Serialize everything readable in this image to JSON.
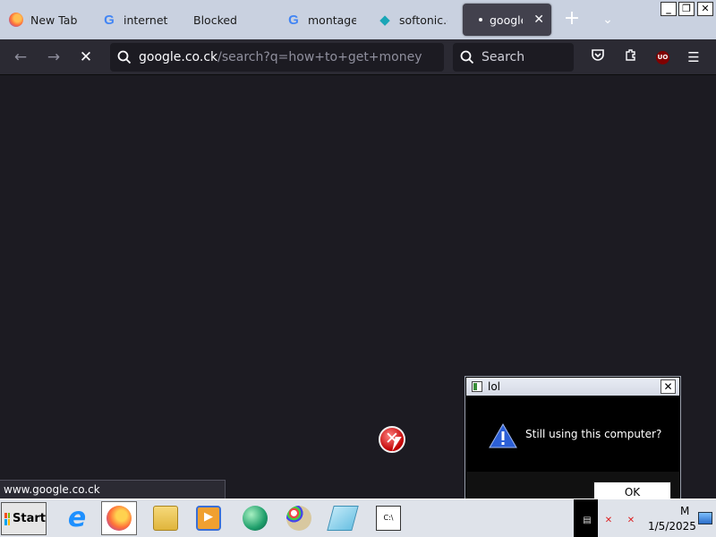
{
  "browser": {
    "tabs": [
      {
        "label": "New Tab",
        "favicon": "firefox-icon"
      },
      {
        "label": "internet ex",
        "favicon": "google-icon"
      },
      {
        "label": "Blocked",
        "favicon": ""
      },
      {
        "label": "montage p",
        "favicon": "google-icon"
      },
      {
        "label": "softonic.co",
        "favicon": "softonic-icon"
      },
      {
        "label": "google.c",
        "favicon": "",
        "active": true
      }
    ],
    "new_tab_glyph": "+",
    "list_tabs_glyph": "⌄",
    "url_host": "google.co.ck",
    "url_path": "/search?q=how+to+get+money",
    "search_placeholder": "Search",
    "status_text": "www.google.co.ck",
    "ublock_label": "UO"
  },
  "dialog": {
    "title": "lol",
    "message": "Still using this computer?",
    "ok_label": "OK",
    "close_glyph": "✕"
  },
  "taskbar": {
    "start_label": "Start",
    "apps": [
      "internet-explorer-icon",
      "firefox-icon",
      "file-explorer-icon",
      "media-player-icon",
      "browser-globe-icon",
      "paint-icon",
      "notepad-icon",
      "command-prompt-icon"
    ],
    "active_app": "firefox-icon",
    "clock_time": "M",
    "clock_date": "1/5/2025"
  },
  "colors": {
    "page_bg": "#1c1b22",
    "toolbar_bg": "#2b2a33",
    "tabstrip_bg": "#c9d1e0",
    "active_tab_bg": "#42414d",
    "dialog_bg": "#000000",
    "taskbar_bg": "#dfe3ea"
  }
}
